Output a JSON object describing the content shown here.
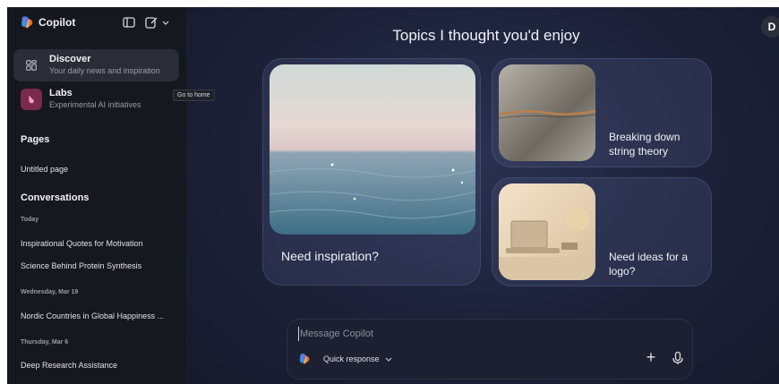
{
  "sidebar": {
    "app_title": "Copilot",
    "nav": [
      {
        "label": "Discover",
        "sub": "Your daily news and inspiration"
      },
      {
        "label": "Labs",
        "sub": "Experimental AI initiatives"
      }
    ],
    "tooltip": "Go to home",
    "pages_heading": "Pages",
    "pages": [
      "Untitled page"
    ],
    "conversations_heading": "Conversations",
    "groups": [
      {
        "date": "Today",
        "items": [
          "Inspirational Quotes for Motivation",
          "Science Behind Protein Synthesis"
        ]
      },
      {
        "date": "Wednesday, Mar 19",
        "items": [
          "Nordic Countries in Global Happiness ..."
        ]
      },
      {
        "date": "Thursday, Mar 6",
        "items": [
          "Deep Research Assistance"
        ]
      }
    ]
  },
  "main": {
    "avatar_initial": "D",
    "heading": "Topics I thought you'd enjoy",
    "cards": [
      {
        "text": "Need inspiration?"
      },
      {
        "text": "Breaking down string theory"
      },
      {
        "text": "Need ideas for a logo?"
      }
    ],
    "composer": {
      "placeholder": "Message Copilot",
      "mode_label": "Quick response",
      "plus": "+"
    }
  },
  "colors": {
    "sidebar_bg": "#16181f",
    "main_bg": "#1c2138",
    "accent": "#3a8de8"
  }
}
